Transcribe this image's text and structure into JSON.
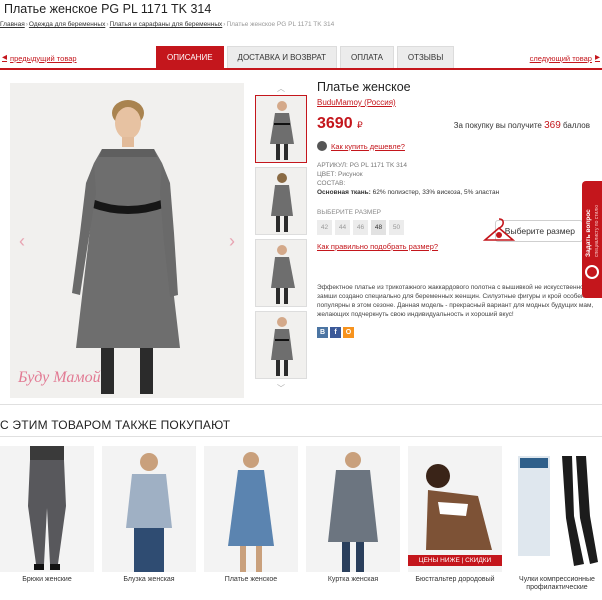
{
  "page": {
    "title": "Платье женское PG PL 1171 TK 314"
  },
  "breadcrumb": {
    "items": [
      "Главная",
      "Одежда для беременных",
      "Платья и сарафаны для беременных"
    ],
    "current": "Платье женское PG PL 1171 TK 314"
  },
  "nav": {
    "prev": "предыдущий товар",
    "next": "следующий товар"
  },
  "tabs": [
    {
      "label": "ОПИСАНИЕ",
      "active": true
    },
    {
      "label": "ДОСТАВКА И ВОЗВРАТ",
      "active": false
    },
    {
      "label": "ОПЛАТА",
      "active": false
    },
    {
      "label": "ОТЗЫВЫ",
      "active": false
    }
  ],
  "gallery": {
    "watermark": "Буду Мамой"
  },
  "product": {
    "title": "Платье женское",
    "brand": "BuduMamoy (Россия)",
    "price": "3690",
    "currency": "₽",
    "bonus_prefix": "За покупку вы получите",
    "bonus_points": "369",
    "bonus_suffix": "баллов",
    "howto_buy": "Как купить дешевле?",
    "article": "АРТИКУЛ: PG PL 1171 TK 314",
    "color": "ЦВЕТ: Рисунок",
    "composition_label": "СОСТАВ:",
    "composition_main_label": "Основная ткань:",
    "composition_main": "62% полиэстер, 33% вискоза, 5% эластан",
    "size_label": "ВЫБЕРИТЕ РАЗМЕР",
    "sizes": [
      "42",
      "44",
      "46",
      "48",
      "50"
    ],
    "size_help": "Как правильно подобрать размер?",
    "size_button": "Выберите размер",
    "description": "Эффектное платье из трикотажного жаккардового полотна с вышивкой не искусственной замши создано специально для беременных женщин. Силуэтные фигуры и крой особенно популярны в этом сезоне. Данная модель - прекрасный вариант для модных будущих мам, желающих подчеркнуть свою индивидуальность и хороший вкус!"
  },
  "social": [
    "В",
    "f",
    "О"
  ],
  "colors": {
    "accent": "#c4161c"
  },
  "ask": {
    "label": "Задать вопрос",
    "sub": "специалисту по стилю"
  },
  "also_bought": {
    "title": "С ЭТИМ ТОВАРОМ ТАКЖЕ ПОКУПАЮТ",
    "items": [
      {
        "caption": "Брюки женские",
        "badge": ""
      },
      {
        "caption": "Блузка женская",
        "badge": ""
      },
      {
        "caption": "Платье женское",
        "badge": ""
      },
      {
        "caption": "Куртка женская",
        "badge": ""
      },
      {
        "caption": "Бюстгальтер дородовый",
        "badge": "ЦЕНЫ НИЖЕ | СКИДКИ"
      },
      {
        "caption": "Чулки компрессионные профилактические",
        "badge": ""
      }
    ]
  }
}
